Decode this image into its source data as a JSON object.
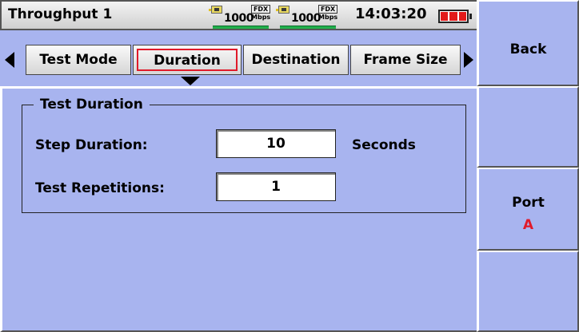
{
  "header": {
    "title": "Throughput 1",
    "port1": {
      "speed": "1000",
      "duplex": "FDX",
      "unit": "Mbps"
    },
    "port2": {
      "speed": "1000",
      "duplex": "FDX",
      "unit": "Mbps"
    },
    "time": "14:03:20",
    "battery_cells": 3,
    "battery_color": "#e21a1a"
  },
  "tabs": [
    {
      "label": "Test Mode",
      "selected": false
    },
    {
      "label": "Duration",
      "selected": true
    },
    {
      "label": "Destination",
      "selected": false
    },
    {
      "label": "Frame Size",
      "selected": false
    }
  ],
  "test_duration": {
    "group_title": "Test Duration",
    "step_duration": {
      "label": "Step Duration:",
      "value": "10",
      "unit": "Seconds"
    },
    "test_repetitions": {
      "label": "Test Repetitions:",
      "value": "1"
    }
  },
  "softkeys": [
    {
      "label": "Back",
      "sub": ""
    },
    {
      "label": "",
      "sub": ""
    },
    {
      "label": "Port",
      "sub": "A"
    },
    {
      "label": "",
      "sub": ""
    }
  ],
  "colors": {
    "panel": "#a8b4ef",
    "selected_tab_outline": "#e01a2a",
    "port_value": "#e01a2a",
    "link_bar": "#22b14c"
  }
}
